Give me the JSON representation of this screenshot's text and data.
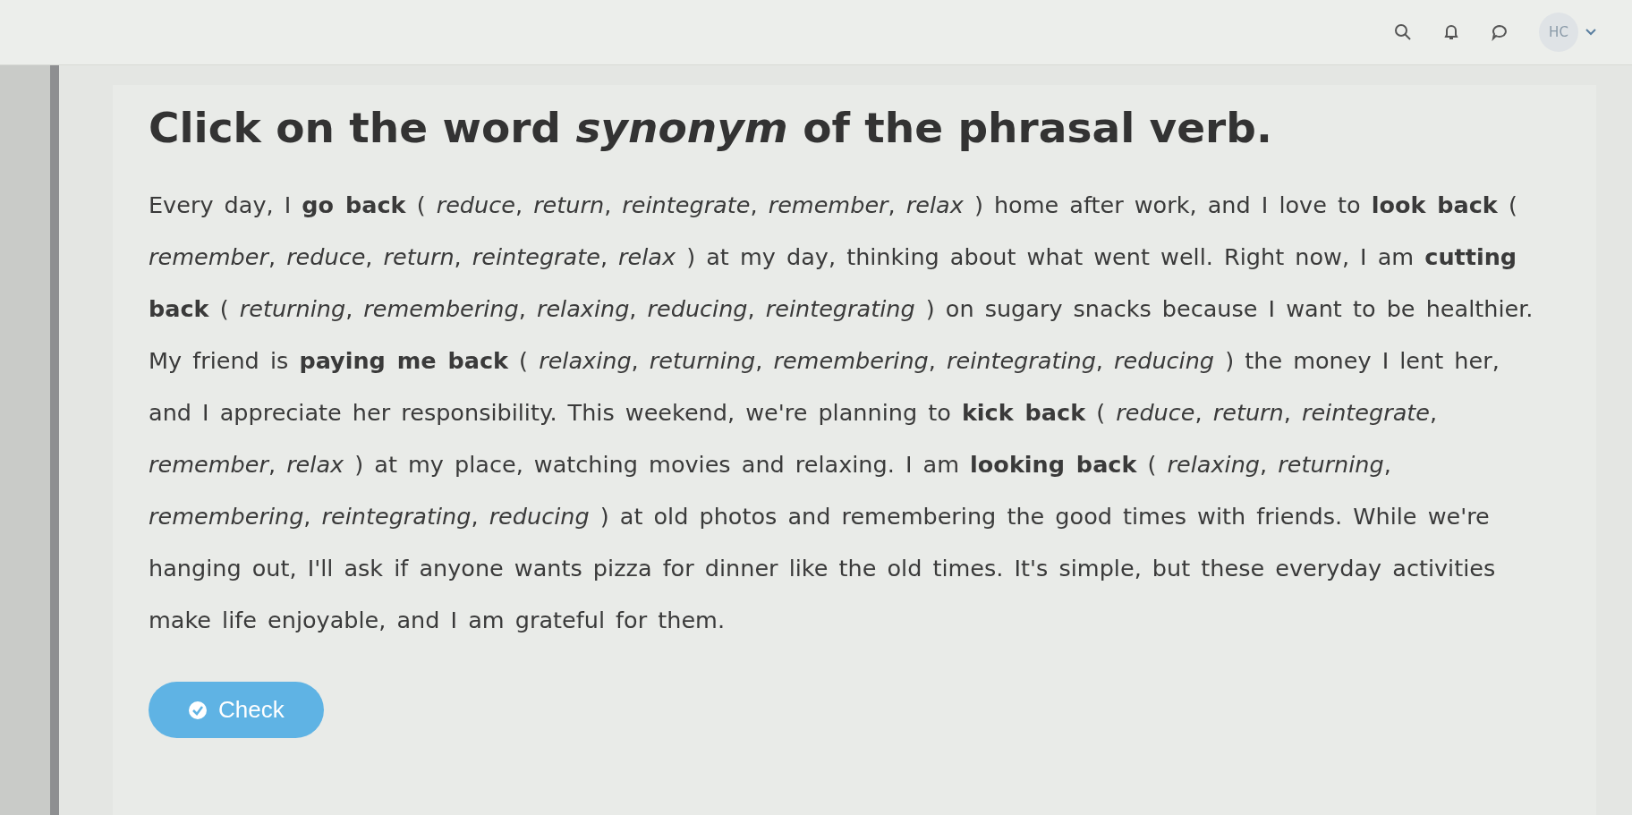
{
  "top_bar": {
    "avatar": "HC"
  },
  "exercise": {
    "title": "Click on the word *synonym* of the phrasal verb.",
    "paragraph": [
      {
        "kind": "text",
        "text": "Every day, I "
      },
      {
        "kind": "verb",
        "text": "go back"
      },
      {
        "kind": "options",
        "open": "(",
        "separator": ",",
        "close": ")",
        "options": [
          "reduce",
          "return",
          "reintegrate",
          "remember",
          "relax"
        ]
      },
      {
        "kind": "text",
        "text": " home after work, and I love to "
      },
      {
        "kind": "verb",
        "text": "look back"
      },
      {
        "kind": "options",
        "open": "(",
        "separator": ",",
        "close": ")",
        "options": [
          "remember",
          "reduce",
          "return",
          "reintegrate",
          "relax"
        ]
      },
      {
        "kind": "text",
        "text": " at my day, thinking about what went well. Right now, I am "
      },
      {
        "kind": "verb",
        "text": "cutting back"
      },
      {
        "kind": "options",
        "open": "(",
        "separator": ",",
        "close": ")",
        "options": [
          "returning",
          "remembering",
          "relaxing",
          "reducing",
          "reintegrating"
        ]
      },
      {
        "kind": "text",
        "text": " on sugary snacks because I want to be healthier. My friend is "
      },
      {
        "kind": "verb",
        "text": "paying me back"
      },
      {
        "kind": "options",
        "open": "(",
        "separator": ",",
        "close": ")",
        "options": [
          "relaxing",
          "returning",
          "remembering",
          "reintegrating",
          "reducing"
        ]
      },
      {
        "kind": "text",
        "text": " the money I lent her, and I appreciate her responsibility. This weekend, we're planning to "
      },
      {
        "kind": "verb",
        "text": "kick back"
      },
      {
        "kind": "options",
        "open": "(",
        "separator": ",",
        "close": ")",
        "options": [
          "reduce",
          "return",
          "reintegrate",
          "remember",
          "relax"
        ]
      },
      {
        "kind": "text",
        "text": " at my place, watching movies and relaxing. I am "
      },
      {
        "kind": "verb",
        "text": "looking back"
      },
      {
        "kind": "options",
        "open": "(",
        "separator": ",",
        "close": ")",
        "options": [
          "relaxing",
          "returning",
          "remembering",
          "reintegrating",
          "reducing"
        ]
      },
      {
        "kind": "text",
        "text": " at old photos and remembering the good times with friends. While we're hanging out, I'll ask if anyone wants pizza for dinner like the old times. It's simple, but these everyday activities make life enjoyable, and I am grateful for them."
      }
    ],
    "button": "Check"
  }
}
